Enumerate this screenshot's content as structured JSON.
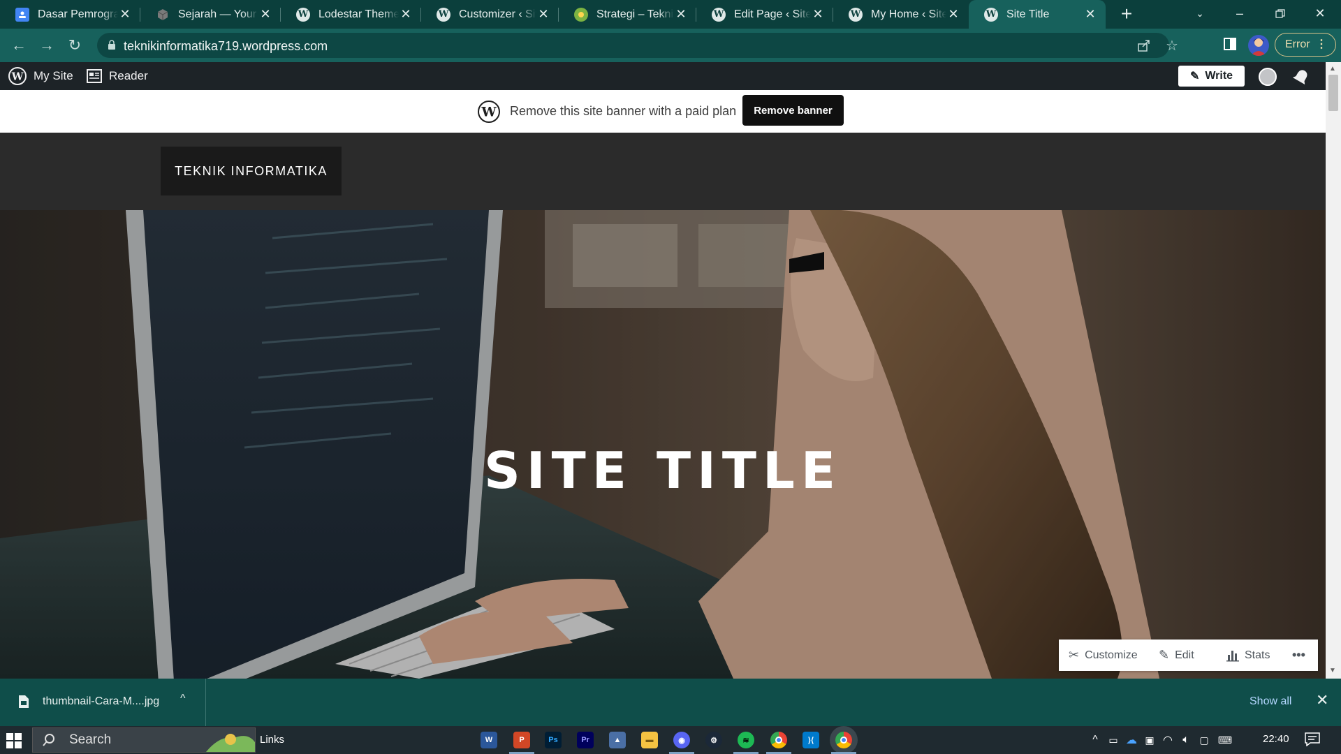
{
  "browser": {
    "tabs": [
      {
        "title": "Dasar Pemrograman",
        "icon": "classroom-icon",
        "color": "#4285f4"
      },
      {
        "title": "Sejarah — Your Site",
        "icon": "cube-icon",
        "color": "#6a6a6a"
      },
      {
        "title": "Lodestar Theme",
        "icon": "wordpress-icon",
        "color": "#dfe9e8"
      },
      {
        "title": "Customizer ‹ Site",
        "icon": "wordpress-icon",
        "color": "#dfe9e8"
      },
      {
        "title": "Strategi – Teknik I",
        "icon": "site-favicon-icon",
        "color": "#7cb342"
      },
      {
        "title": "Edit Page ‹ Site Ti",
        "icon": "wordpress-icon",
        "color": "#dfe9e8"
      },
      {
        "title": "My Home ‹ Site T",
        "icon": "wordpress-icon",
        "color": "#dfe9e8"
      },
      {
        "title": "Site Title",
        "icon": "wordpress-icon",
        "color": "#dfe9e8",
        "active": true
      }
    ],
    "url": "teknikinformatika719.wordpress.com",
    "error_label": "Error",
    "theme_color": "#17615c"
  },
  "wp_admin_bar": {
    "my_site": "My Site",
    "reader": "Reader",
    "write": "Write"
  },
  "banner": {
    "text": "Remove this site banner with a paid plan",
    "button": "Remove banner"
  },
  "site": {
    "brand": "TEKNIK INFORMATIKA",
    "hero_title": "SITE TITLE"
  },
  "edit_toolbar": {
    "customize": "Customize",
    "edit": "Edit",
    "stats": "Stats"
  },
  "downloads": {
    "file_name": "thumbnail-Cara-M....jpg",
    "show_all": "Show all"
  },
  "taskbar": {
    "search_placeholder": "Search",
    "links_label": "Links",
    "apps": [
      "word-icon",
      "powerpoint-icon",
      "photoshop-icon",
      "premiere-icon",
      "photos-icon",
      "file-explorer-icon",
      "discord-icon",
      "steam-icon",
      "spotify-icon",
      "chrome-icon",
      "vscode-icon",
      "chrome-icon"
    ],
    "clock": "22:40"
  }
}
